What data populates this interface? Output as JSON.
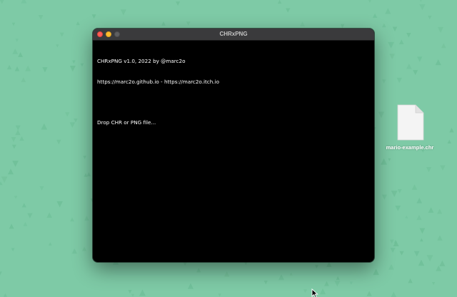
{
  "desktop": {
    "background_color": "#7ecaa6",
    "pattern_color": "#6fbf98"
  },
  "window": {
    "title": "CHRxPNG",
    "buttons": {
      "close_color": "#fe5f57",
      "minimize_color": "#febc2e",
      "maximize_color": "#5f5f61"
    },
    "console_lines": [
      "CHRxPNG v1.0, 2022 by @marc2o",
      "https://marc2o.github.io - https://marc2o.itch.io",
      "",
      "Drop CHR or PNG file..."
    ]
  },
  "desktop_file": {
    "name": "mario-example.chr",
    "icon": "document-file-icon"
  },
  "pointer": {
    "icon": "mouse-cursor-icon"
  }
}
